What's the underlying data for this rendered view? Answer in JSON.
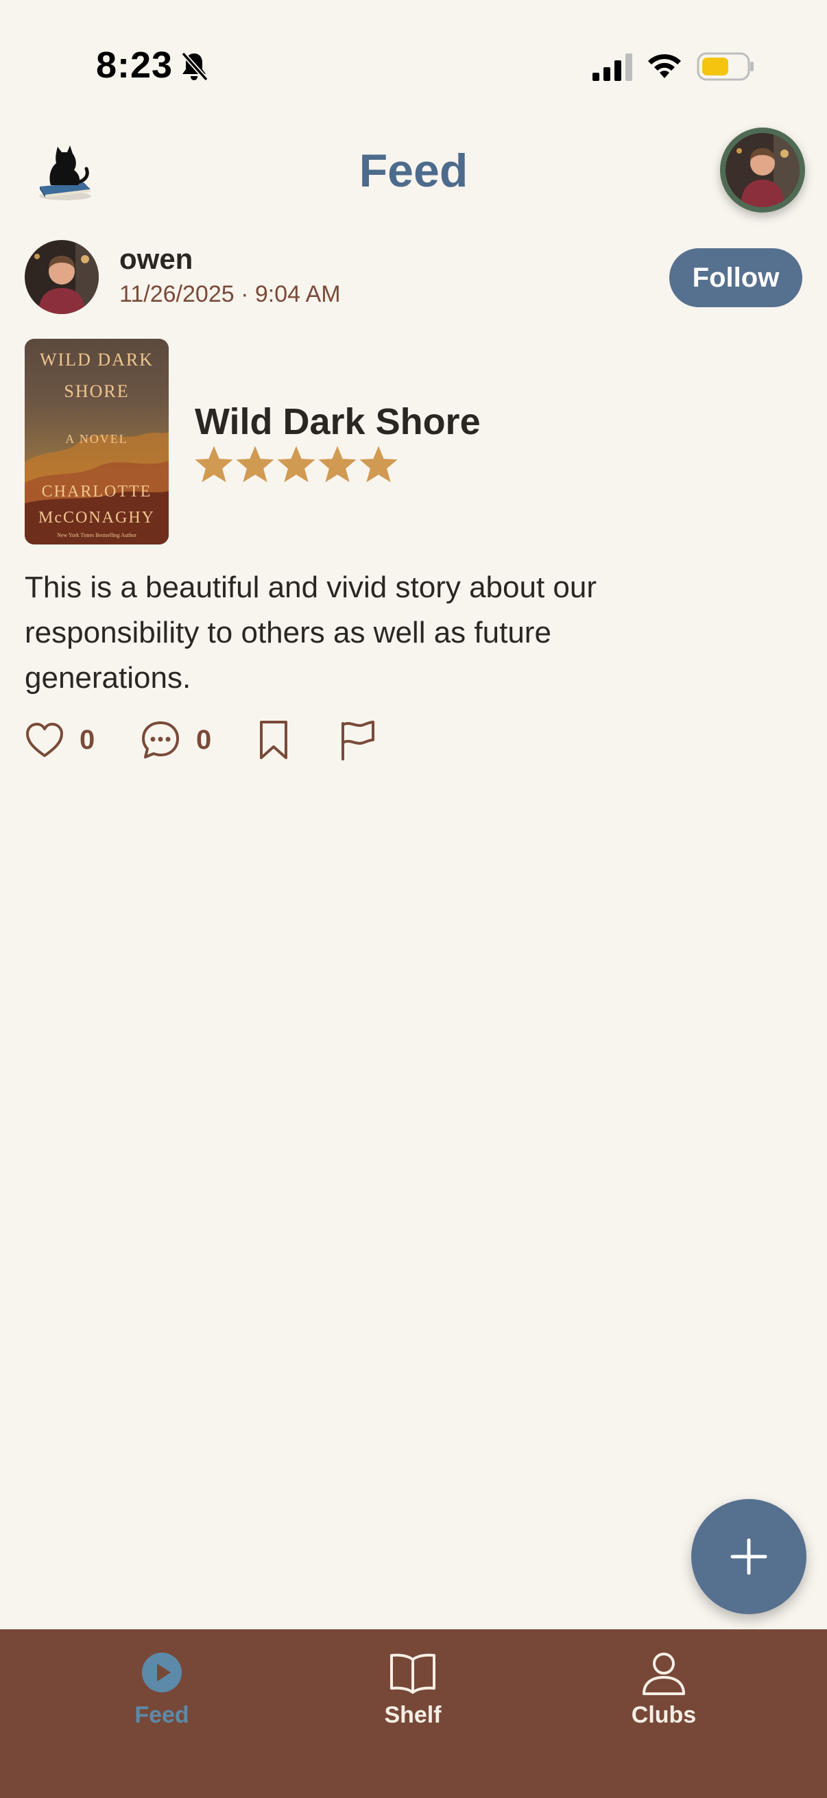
{
  "status_bar": {
    "time": "8:23",
    "icons": [
      "bell-off-icon",
      "cellular-signal-icon",
      "wifi-icon",
      "battery-icon"
    ]
  },
  "header": {
    "title": "Feed",
    "logo_icon": "cat-on-book-icon",
    "avatar_icon": "profile-avatar"
  },
  "post": {
    "username": "owen",
    "timestamp": "11/26/2025 · 9:04 AM",
    "follow_label": "Follow",
    "book": {
      "title": "Wild Dark Shore",
      "rating": 5,
      "rating_max": 5,
      "cover_text": {
        "line1": "WILD DARK",
        "line2": "SHORE",
        "line3": "A NOVEL",
        "line4": "CHARLOTTE",
        "line5": "McCONAGHY",
        "line6": "New York Times Bestselling Author"
      }
    },
    "review": "This is a beautiful and vivid story about our responsibility to others as well as future generations.",
    "likes": "0",
    "comments": "0"
  },
  "fab": {
    "icon": "plus-icon"
  },
  "bottom_nav": {
    "items": [
      {
        "label": "Feed",
        "icon": "play-circle-icon",
        "active": true
      },
      {
        "label": "Shelf",
        "icon": "open-book-icon",
        "active": false
      },
      {
        "label": "Clubs",
        "icon": "person-icon",
        "active": false
      }
    ]
  },
  "colors": {
    "background": "#f8f5ee",
    "accent_blue": "#56708f",
    "title_blue": "#4d6b8c",
    "brown": "#774838",
    "star": "#d19a52",
    "timestamp": "#7a4a39",
    "active_nav": "#5d8aa9"
  }
}
